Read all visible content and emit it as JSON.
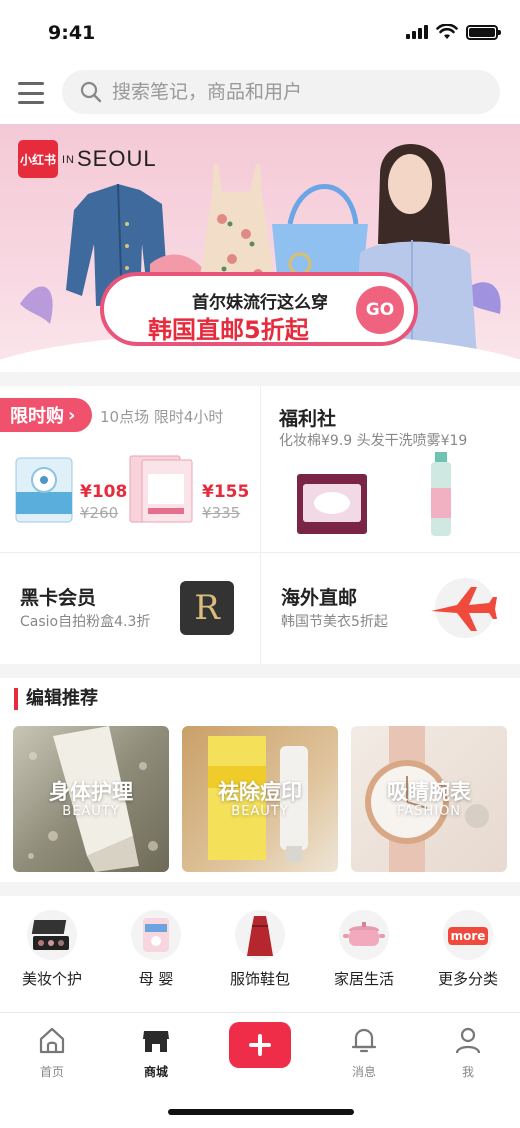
{
  "status_bar": {
    "time": "9:41"
  },
  "search": {
    "placeholder": "搜索笔记，商品和用户"
  },
  "banner": {
    "brand_logo": "小红书",
    "brand_in": "IN",
    "brand_city": "SEOUL",
    "line1": "首尔妹流行这么穿",
    "line2": "韩国直邮5折起",
    "go_label": "GO",
    "accent_color": "#e8547a"
  },
  "promo": {
    "flash": {
      "tag": "限时购",
      "subtitle": "10点场 限时4小时",
      "items": [
        {
          "price": "¥108",
          "original": "¥260"
        },
        {
          "price": "¥155",
          "original": "¥335"
        }
      ]
    },
    "welfare": {
      "title": "福利社",
      "subtitle": "化妆棉¥9.9 头发干洗喷雾¥19"
    },
    "black_card": {
      "title": "黑卡会员",
      "subtitle": "Casio自拍粉盒4.3折",
      "badge": "R"
    },
    "overseas": {
      "title": "海外直邮",
      "subtitle": "韩国节美衣5折起"
    }
  },
  "editor": {
    "title": "编辑推荐",
    "cards": [
      {
        "title": "身体护理",
        "subtitle": "BEAUTY"
      },
      {
        "title": "祛除痘印",
        "subtitle": "BEAUTY"
      },
      {
        "title": "吸睛腕表",
        "subtitle": "FASHION"
      }
    ]
  },
  "categories": [
    {
      "label": "美妆个护",
      "icon": "makeup-palette-icon"
    },
    {
      "label": "母 婴",
      "icon": "baby-diaper-icon"
    },
    {
      "label": "服饰鞋包",
      "icon": "dress-icon"
    },
    {
      "label": "家居生活",
      "icon": "cookware-pot-icon"
    },
    {
      "label": "更多分类",
      "icon": "more-icon",
      "badge": "more"
    }
  ],
  "bottom_nav": {
    "home": "首页",
    "mall": "商城",
    "messages": "消息",
    "me": "我",
    "brand_color": "#ef2d48"
  }
}
